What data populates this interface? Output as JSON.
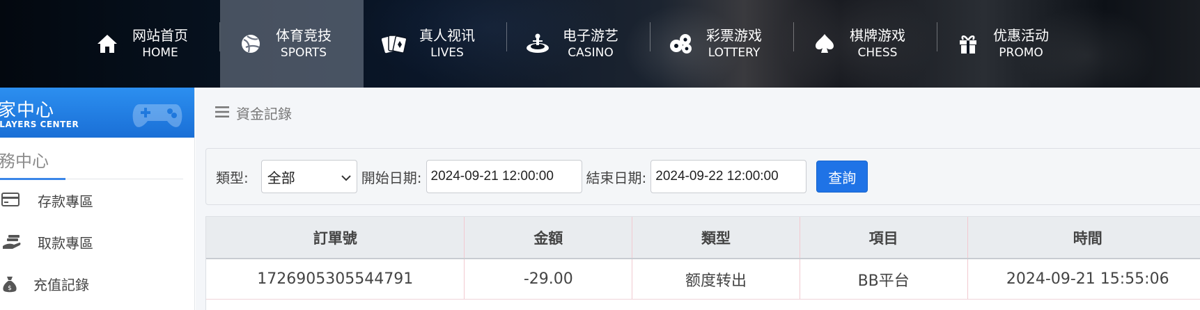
{
  "nav": {
    "items": [
      {
        "cn": "网站首页",
        "en": "HOME",
        "icon": "home-icon"
      },
      {
        "cn": "体育竞技",
        "en": "SPORTS",
        "icon": "ball-icon"
      },
      {
        "cn": "真人视讯",
        "en": "LIVES",
        "icon": "cards-icon"
      },
      {
        "cn": "电子游艺",
        "en": "CASINO",
        "icon": "roulette-icon"
      },
      {
        "cn": "彩票游戏",
        "en": "LOTTERY",
        "icon": "lottery-balls-icon"
      },
      {
        "cn": "棋牌游戏",
        "en": "CHESS",
        "icon": "spade-icon"
      },
      {
        "cn": "优惠活动",
        "en": "PROMO",
        "icon": "gift-icon"
      }
    ],
    "active_index": 1
  },
  "sidebar": {
    "banner_title": "玩家中心",
    "banner_subtitle": "PLAYERS CENTER",
    "section_title": "財務中心",
    "items": [
      {
        "label": "存款專區",
        "icon": "card-icon"
      },
      {
        "label": "取款專區",
        "icon": "withdraw-hand-icon"
      },
      {
        "label": "充值記錄",
        "icon": "money-bag-icon"
      }
    ]
  },
  "breadcrumb": {
    "icon": "menu-icon",
    "text": "資金記錄"
  },
  "filter": {
    "type_label": "類型:",
    "type_value": "全部",
    "start_label": "開始日期:",
    "start_value": "2024-09-21 12:00:00",
    "end_label": "結束日期:",
    "end_value": "2024-09-22 12:00:00",
    "query_button": "查詢"
  },
  "table": {
    "headers": [
      "訂單號",
      "金額",
      "類型",
      "項目",
      "時間"
    ],
    "rows": [
      [
        "1726905305544791",
        "-29.00",
        "额度转出",
        "BB平台",
        "2024-09-21 15:55:06"
      ]
    ]
  },
  "colors": {
    "accent_blue": "#1f73e6",
    "banner_blue": "#2c8ff0",
    "table_header_bg": "#e9ecef"
  }
}
